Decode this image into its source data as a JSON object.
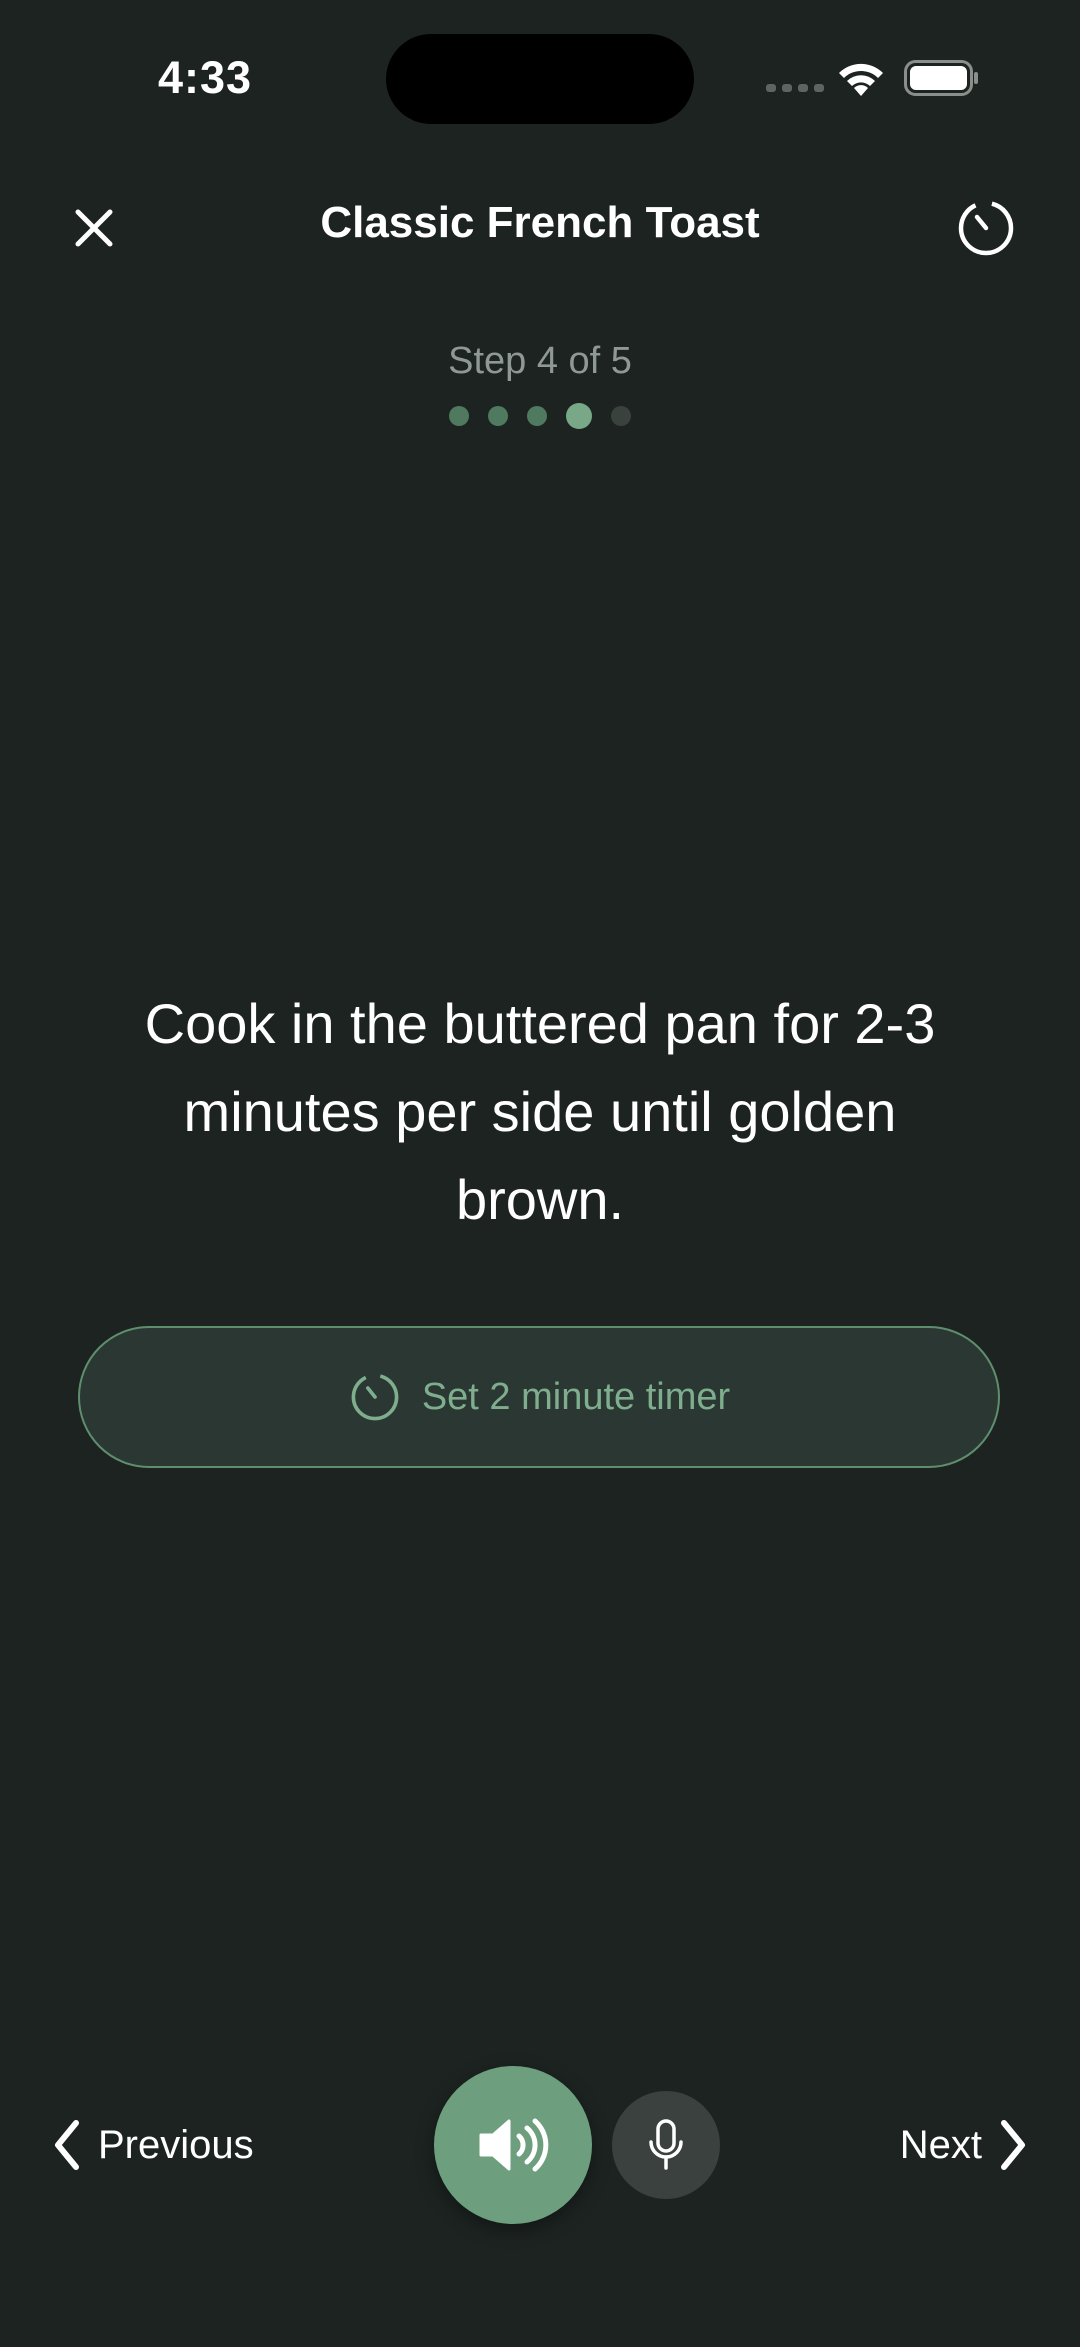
{
  "status_bar": {
    "time": "4:33"
  },
  "header": {
    "title": "Classic French Toast",
    "close_icon": "close-icon",
    "timer_icon": "timer-icon"
  },
  "progress": {
    "label": "Step 4 of 5",
    "current_step": 4,
    "total_steps": 5
  },
  "step": {
    "instruction": "Cook in the buttered pan for 2-3 minutes per side until golden brown.",
    "timer_button_label": "Set 2 minute timer"
  },
  "controls": {
    "previous_label": "Previous",
    "next_label": "Next",
    "speaker_icon": "speaker-icon",
    "mic_icon": "microphone-icon"
  },
  "colors": {
    "background": "#1c2320",
    "accent": "#6d9f7e",
    "accent_text": "#7fae8e",
    "muted_text": "#8f9894"
  }
}
